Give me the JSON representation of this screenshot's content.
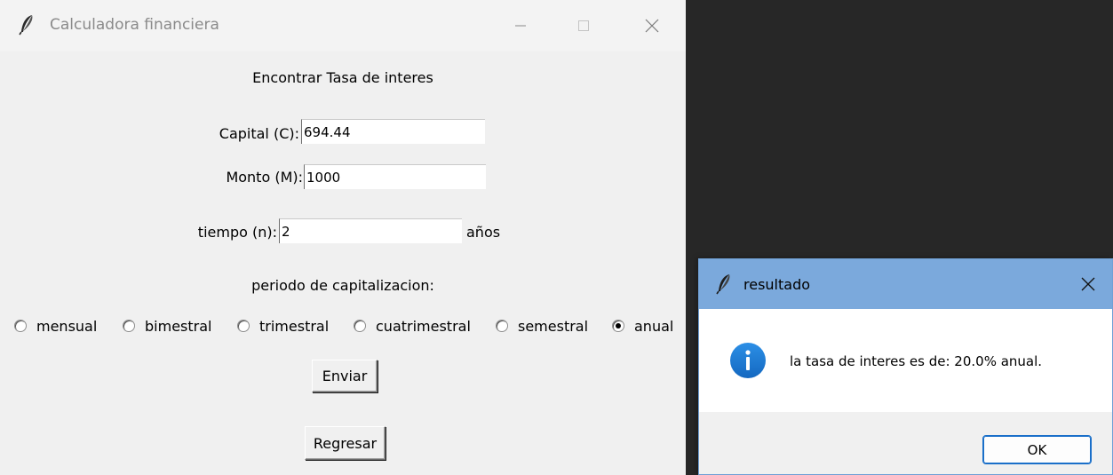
{
  "main_window": {
    "title": "Calculadora financiera",
    "heading": "Encontrar Tasa de interes",
    "capital": {
      "label": "Capital (C):",
      "value": "694.44"
    },
    "monto": {
      "label": "Monto (M):",
      "value": "1000"
    },
    "tiempo": {
      "label": "tiempo (n):",
      "value": "2",
      "unit": "años"
    },
    "period_label": "periodo de capitalizacion:",
    "periods": [
      {
        "label": "mensual",
        "selected": false
      },
      {
        "label": "bimestral",
        "selected": false
      },
      {
        "label": "trimestral",
        "selected": false
      },
      {
        "label": "cuatrimestral",
        "selected": false
      },
      {
        "label": "semestral",
        "selected": false
      },
      {
        "label": "anual",
        "selected": true
      }
    ],
    "submit_label": "Enviar",
    "back_label": "Regresar"
  },
  "dialog": {
    "title": "resultado",
    "message": "la tasa de interes es de: 20.0% anual.",
    "icon": "info-icon",
    "ok_label": "OK"
  },
  "colors": {
    "window_bg": "#f0f0f0",
    "desktop_bg": "#272727",
    "dialog_titlebar": "#7ba9dc",
    "info_icon": "#1a73c8",
    "ok_border": "#1a6fc9"
  }
}
